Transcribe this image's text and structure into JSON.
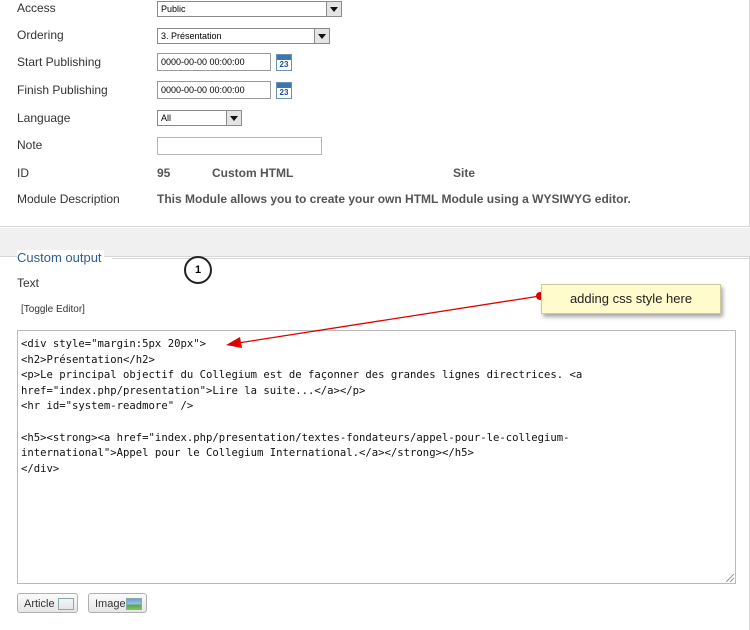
{
  "form": {
    "access": {
      "label": "Access",
      "value": "Public"
    },
    "ordering": {
      "label": "Ordering",
      "value": "3. Présentation"
    },
    "start_publishing": {
      "label": "Start Publishing",
      "value": "0000-00-00 00:00:00"
    },
    "finish_publishing": {
      "label": "Finish Publishing",
      "value": "0000-00-00 00:00:00"
    },
    "language": {
      "label": "Language",
      "value": "All"
    },
    "note": {
      "label": "Note",
      "value": ""
    },
    "id": {
      "label": "ID",
      "value": "95",
      "type": "Custom HTML",
      "client": "Site"
    },
    "description": {
      "label": "Module Description",
      "value": "This Module allows you to create your own HTML Module using a WYSIWYG editor."
    },
    "calendar_day": "23"
  },
  "custom_output": {
    "title": "Custom output",
    "text_label": "Text",
    "toggle_editor": "[Toggle Editor]",
    "code_lines": [
      "<div style=\"margin:5px 20px\">",
      "<h2>Présentation</h2>",
      "<p>Le principal objectif du Collegium est de façonner des grandes lignes directrices. <a",
      "href=\"index.php/presentation\">Lire la suite...</a></p>",
      "<hr id=\"system-readmore\" />",
      "",
      "<h5><strong><a href=\"index.php/presentation/textes-fondateurs/appel-pour-le-collegium-",
      "international\">Appel pour le Collegium International.</a></strong></h5>",
      "</div>"
    ],
    "buttons": {
      "article": "Article",
      "image": "Image"
    }
  },
  "annotation": {
    "step_number": "1",
    "callout_text": "adding css style here",
    "arrow_color": "#e00000"
  }
}
